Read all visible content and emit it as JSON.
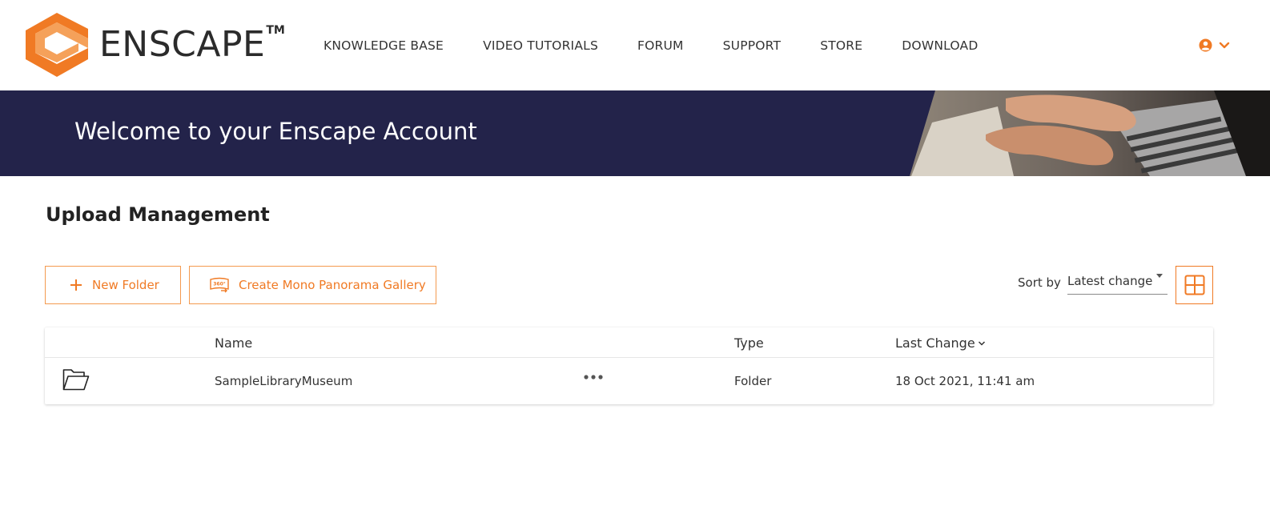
{
  "brand": {
    "name": "ENSCAPE",
    "trademark": "TM",
    "accent_color": "#f07a24",
    "navy_color": "#23234a"
  },
  "nav": {
    "items": [
      {
        "label": "KNOWLEDGE BASE"
      },
      {
        "label": "VIDEO TUTORIALS"
      },
      {
        "label": "FORUM"
      },
      {
        "label": "SUPPORT"
      },
      {
        "label": "STORE"
      },
      {
        "label": "DOWNLOAD"
      }
    ],
    "account_icon": "user-circle-icon",
    "account_caret_icon": "chevron-down-icon"
  },
  "banner": {
    "title": "Welcome to your Enscape Account"
  },
  "page": {
    "title": "Upload Management"
  },
  "toolbar": {
    "new_folder_label": "New Folder",
    "gallery_label": "Create Mono Panorama Gallery",
    "gallery_icon_text": "360°",
    "sort_label": "Sort by",
    "sort_value": "Latest change",
    "view_icon": "grid-view-icon"
  },
  "table": {
    "columns": {
      "name": "Name",
      "type": "Type",
      "last_change": "Last Change"
    },
    "rows": [
      {
        "icon": "folder-open-icon",
        "name": "SampleLibraryMuseum",
        "type": "Folder",
        "last_change": "18 Oct 2021, 11:41 am"
      }
    ]
  }
}
